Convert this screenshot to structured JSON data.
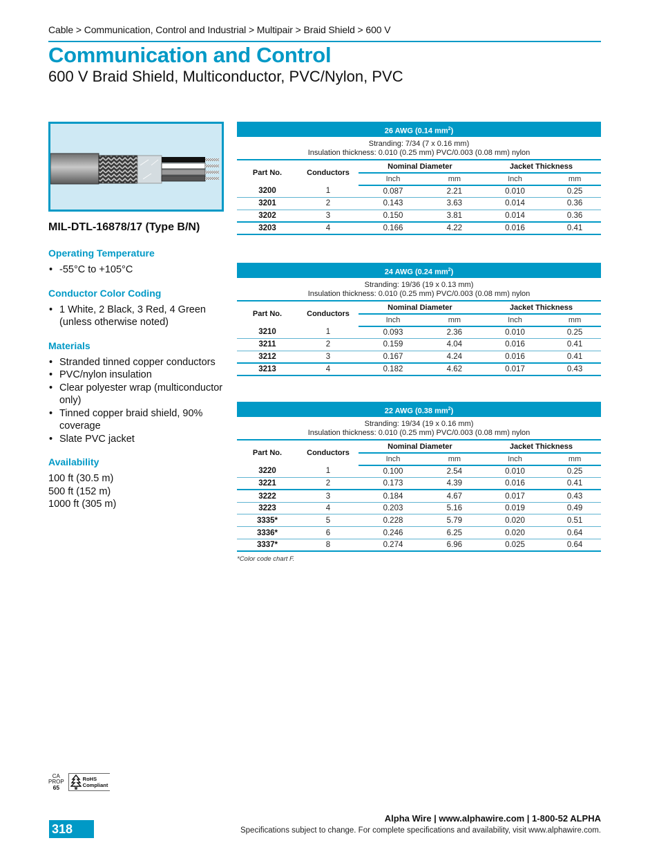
{
  "breadcrumb": "Cable > Communication, Control and Industrial > Multipair > Braid Shield > 600 V",
  "title": "Communication and Control",
  "subtitle": "600 V Braid Shield, Multiconductor, PVC/Nylon, PVC",
  "figure": {
    "icon": "cable-cross-section-illustration",
    "bg_color": "#cfe9f4",
    "border_color": "#0099c6"
  },
  "spec_title": "MIL-DTL-16878/17 (Type B/N)",
  "sections": {
    "temperature": {
      "heading": "Operating Temperature",
      "items": [
        "-55°C to +105°C"
      ]
    },
    "color_coding": {
      "heading": "Conductor Color Coding",
      "items": [
        "1 White, 2 Black, 3 Red, 4 Green (unless otherwise noted)"
      ]
    },
    "materials": {
      "heading": "Materials",
      "items": [
        "Stranded tinned copper conductors",
        "PVC/nylon insulation",
        "Clear polyester wrap (multiconductor only)",
        "Tinned copper braid shield, 90% coverage",
        "Slate PVC jacket"
      ]
    },
    "availability": {
      "heading": "Availability",
      "items": [
        "100 ft (30.5 m)",
        "500 ft (152 m)",
        "1000 ft (305 m)"
      ]
    }
  },
  "table_headers": {
    "part_no": "Part No.",
    "conductors": "Conductors",
    "nominal_diameter": "Nominal Diameter",
    "jacket_thickness": "Jacket Thickness",
    "inch": "Inch",
    "mm": "mm"
  },
  "tables": [
    {
      "awg": "26 AWG (0.14 mm",
      "awg_sup": "2",
      "awg_close": ")",
      "stranding": "Stranding: 7/34 (7 x 0.16 mm)",
      "insulation": "Insulation thickness: 0.010 (0.25 mm) PVC/0.003 (0.08 mm) nylon",
      "rows": [
        [
          "3200",
          "1",
          "0.087",
          "2.21",
          "0.010",
          "0.25"
        ],
        [
          "3201",
          "2",
          "0.143",
          "3.63",
          "0.014",
          "0.36"
        ],
        [
          "3202",
          "3",
          "0.150",
          "3.81",
          "0.014",
          "0.36"
        ],
        [
          "3203",
          "4",
          "0.166",
          "4.22",
          "0.016",
          "0.41"
        ]
      ]
    },
    {
      "awg": "24 AWG (0.24 mm",
      "awg_sup": "2",
      "awg_close": ")",
      "stranding": "Stranding: 19/36 (19 x 0.13 mm)",
      "insulation": "Insulation thickness: 0.010 (0.25 mm) PVC/0.003 (0.08 mm) nylon",
      "rows": [
        [
          "3210",
          "1",
          "0.093",
          "2.36",
          "0.010",
          "0.25"
        ],
        [
          "3211",
          "2",
          "0.159",
          "4.04",
          "0.016",
          "0.41"
        ],
        [
          "3212",
          "3",
          "0.167",
          "4.24",
          "0.016",
          "0.41"
        ],
        [
          "3213",
          "4",
          "0.182",
          "4.62",
          "0.017",
          "0.43"
        ]
      ]
    },
    {
      "awg": "22 AWG (0.38 mm",
      "awg_sup": "2",
      "awg_close": ")",
      "stranding": "Stranding: 19/34 (19 x 0.16 mm)",
      "insulation": "Insulation thickness: 0.010 (0.25 mm) PVC/0.003 (0.08 mm) nylon",
      "rows": [
        [
          "3220",
          "1",
          "0.100",
          "2.54",
          "0.010",
          "0.25"
        ],
        [
          "3221",
          "2",
          "0.173",
          "4.39",
          "0.016",
          "0.41"
        ],
        [
          "3222",
          "3",
          "0.184",
          "4.67",
          "0.017",
          "0.43"
        ],
        [
          "3223",
          "4",
          "0.203",
          "5.16",
          "0.019",
          "0.49"
        ],
        [
          "3335*",
          "5",
          "0.228",
          "5.79",
          "0.020",
          "0.51"
        ],
        [
          "3336*",
          "6",
          "0.246",
          "6.25",
          "0.020",
          "0.64"
        ],
        [
          "3337*",
          "8",
          "0.274",
          "6.96",
          "0.025",
          "0.64"
        ]
      ],
      "footnote": "*Color code chart F."
    }
  ],
  "certifications": {
    "prop65": [
      "CA",
      "PROP",
      "65"
    ],
    "rohs": [
      "RoHS",
      "Compliant"
    ]
  },
  "footer": {
    "page_number": "318",
    "brand_line": "Alpha Wire | www.alphawire.com | 1-800-52 ALPHA",
    "note": "Specifications subject to change. For complete specifications and availability, visit www.alphawire.com."
  },
  "colors": {
    "accent": "#0099c6"
  }
}
